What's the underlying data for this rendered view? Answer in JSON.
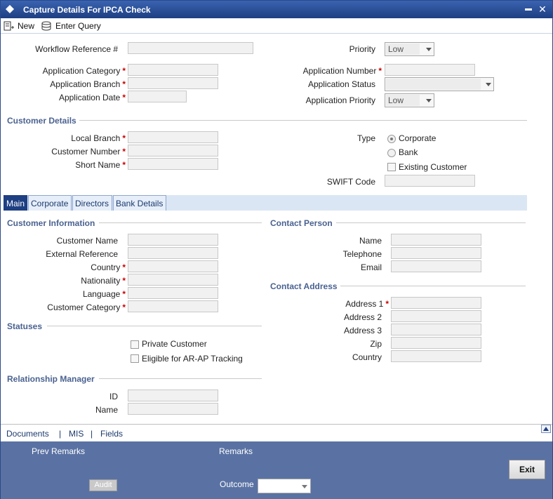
{
  "window": {
    "title": "Capture Details For IPCA Check",
    "minimize_glyph": "▬",
    "close_glyph": "✕"
  },
  "toolbar": {
    "new_label": "New",
    "enter_query_label": "Enter Query"
  },
  "header": {
    "workflow_reference_label": "Workflow Reference #",
    "application_category_label": "Application Category",
    "application_branch_label": "Application Branch",
    "application_date_label": "Application Date",
    "priority_label": "Priority",
    "priority_value": "Low",
    "application_number_label": "Application Number",
    "application_status_label": "Application Status",
    "application_priority_label": "Application Priority",
    "application_priority_value": "Low",
    "required_mark": "*"
  },
  "customer_details": {
    "section_title": "Customer Details",
    "local_branch_label": "Local Branch",
    "customer_number_label": "Customer Number",
    "short_name_label": "Short Name",
    "type_label": "Type",
    "type_options": [
      "Corporate",
      "Bank"
    ],
    "existing_customer_label": "Existing Customer",
    "swift_code_label": "SWIFT Code"
  },
  "tabs": [
    "Main",
    "Corporate",
    "Directors",
    "Bank Details"
  ],
  "customer_information": {
    "section_title": "Customer Information",
    "customer_name_label": "Customer Name",
    "external_reference_label": "External Reference",
    "country_label": "Country",
    "nationality_label": "Nationality",
    "language_label": "Language",
    "customer_category_label": "Customer Category"
  },
  "contact_person": {
    "section_title": "Contact Person",
    "name_label": "Name",
    "telephone_label": "Telephone",
    "email_label": "Email"
  },
  "contact_address": {
    "section_title": "Contact Address",
    "address1_label": "Address 1",
    "address2_label": "Address 2",
    "address3_label": "Address 3",
    "zip_label": "Zip",
    "country_label": "Country"
  },
  "statuses": {
    "section_title": "Statuses",
    "private_customer_label": "Private Customer",
    "eligible_label": "Eligible for AR-AP Tracking"
  },
  "relationship_manager": {
    "section_title": "Relationship Manager",
    "id_label": "ID",
    "name_label": "Name"
  },
  "footer": {
    "documents_label": "Documents",
    "mis_label": "MIS",
    "fields_label": "Fields",
    "separator": "|",
    "prev_remarks_label": "Prev Remarks",
    "remarks_label": "Remarks",
    "outcome_label": "Outcome",
    "audit_label": "Audit",
    "exit_label": "Exit"
  },
  "colors": {
    "title_bar": "#1e3f82",
    "section_title": "#4a6290",
    "required": "#cc0000",
    "bottom_panel": "#5a72a3"
  }
}
